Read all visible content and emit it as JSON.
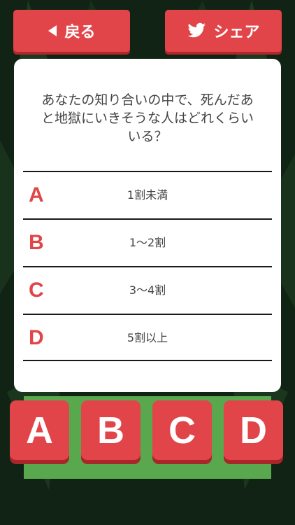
{
  "header": {
    "back_label": "戻る",
    "share_label": "シェア",
    "back_icon": "triangle-left-icon",
    "share_icon": "twitter-bird-icon"
  },
  "question": {
    "text": "あなたの知り合いの中で、死んだあと地獄にいきそうな人はどれくらいいる？"
  },
  "options": [
    {
      "letter": "A",
      "text": "1割未満"
    },
    {
      "letter": "B",
      "text": "1〜2割"
    },
    {
      "letter": "C",
      "text": "3〜4割"
    },
    {
      "letter": "D",
      "text": "5割以上"
    }
  ],
  "answer_buttons": [
    "A",
    "B",
    "C",
    "D"
  ],
  "colors": {
    "accent_red": "#e24549",
    "background": "#0f1f12",
    "grass_green": "#5aa84e"
  }
}
